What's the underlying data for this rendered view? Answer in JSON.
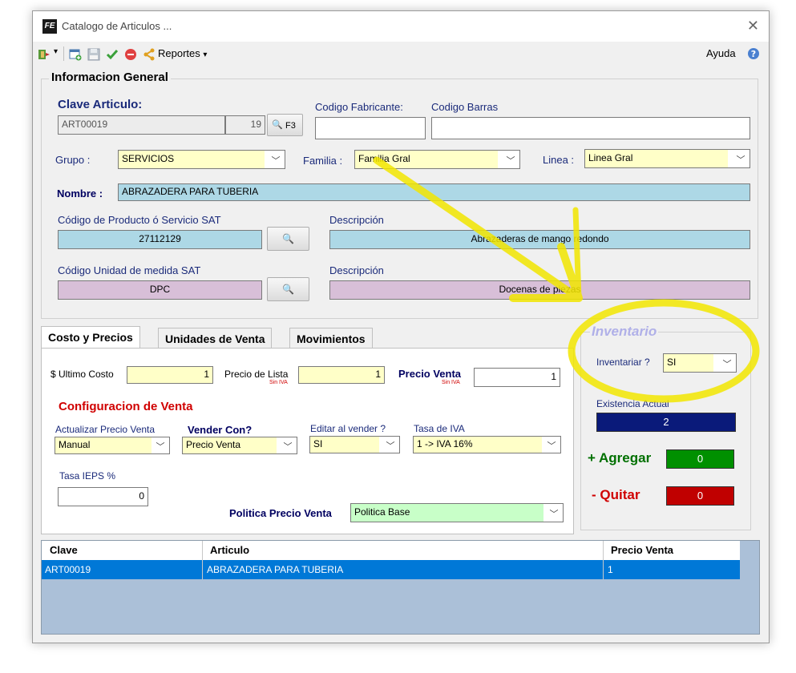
{
  "window": {
    "title": "Catalogo de Articulos ..."
  },
  "toolbar": {
    "reportes": "Reportes",
    "ayuda": "Ayuda"
  },
  "general": {
    "group_title": "Informacion General",
    "clave_label": "Clave Articulo:",
    "clave_value": "ART00019",
    "clave_num": "19",
    "f3_label": "F3",
    "codigo_fabricante_label": "Codigo Fabricante:",
    "codigo_fabricante_value": "",
    "codigo_barras_label": "Codigo Barras",
    "codigo_barras_value": "",
    "grupo_label": "Grupo :",
    "grupo_value": "SERVICIOS",
    "familia_label": "Familia :",
    "familia_value": "Familia Gral",
    "linea_label": "Linea :",
    "linea_value": "Linea Gral",
    "nombre_label": "Nombre :",
    "nombre_value": "ABRAZADERA PARA TUBERIA",
    "sat_codigo_label": "Código de Producto ó Servicio SAT",
    "sat_codigo_value": "27112129",
    "sat_desc_label": "Descripción",
    "sat_desc_value": "Abrazaderas de mango redondo",
    "unidad_label": "Código Unidad de medida SAT",
    "unidad_value": "DPC",
    "unidad_desc_label": "Descripción",
    "unidad_desc_value": "Docenas de piezas"
  },
  "tabs": [
    {
      "label": "Costo y Precios"
    },
    {
      "label": "Unidades de Venta"
    },
    {
      "label": "Movimientos"
    }
  ],
  "precios": {
    "ultimo_costo_label": "$ Ultimo Costo",
    "ultimo_costo_value": "1",
    "precio_lista_label": "Precio de Lista",
    "precio_lista_sub": "Sin IVA",
    "precio_lista_value": "1",
    "precio_venta_label": "Precio Venta",
    "precio_venta_sub": "Sin IVA",
    "precio_venta_value": "1",
    "config_title": "Configuracion de Venta",
    "actualizar_label": "Actualizar Precio Venta",
    "actualizar_value": "Manual",
    "vender_con_label": "Vender Con?",
    "vender_con_value": "Precio Venta",
    "editar_label": "Editar al vender ?",
    "editar_value": "SI",
    "tasa_iva_label": "Tasa de IVA",
    "tasa_iva_value": "1 -> IVA 16%",
    "tasa_ieps_label": "Tasa IEPS %",
    "tasa_ieps_value": "0",
    "politica_label": "Politica Precio Venta",
    "politica_value": "Politica Base"
  },
  "inventario": {
    "title": "Inventario",
    "inventariar_label": "Inventariar ?",
    "inventariar_value": "SI",
    "existencia_label": "Existencia Actual",
    "existencia_value": "2",
    "agregar_label": "+ Agregar",
    "agregar_value": "0",
    "quitar_label": "- Quitar",
    "quitar_value": "0"
  },
  "grid": {
    "headers": [
      "Clave",
      "Articulo",
      "Precio Venta"
    ],
    "rows": [
      [
        "ART00019",
        "ABRAZADERA PARA TUBERIA",
        "1"
      ]
    ]
  },
  "colors": {
    "annotation": "#f2e600",
    "selection": "#0078d7",
    "existencia_bg": "#0a1a7a",
    "agregar_bg": "#009000",
    "quitar_bg": "#c00000"
  }
}
